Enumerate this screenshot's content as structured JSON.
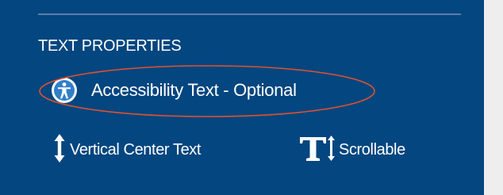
{
  "panel": {
    "section_title": "TEXT PROPERTIES",
    "accessibility": {
      "label": "Accessibility Text - Optional",
      "icon": "accessibility-icon"
    },
    "options": {
      "vertical_center": {
        "label": "Vertical Center Text",
        "icon": "vertical-arrows-icon"
      },
      "scrollable": {
        "label": "Scrollable",
        "icon": "text-height-icon"
      }
    }
  },
  "colors": {
    "panel_background": "#034680",
    "page_background": "#eeeeee",
    "divider": "#5a7fa6",
    "highlight_ellipse": "#e0522c",
    "text": "#ffffff"
  }
}
